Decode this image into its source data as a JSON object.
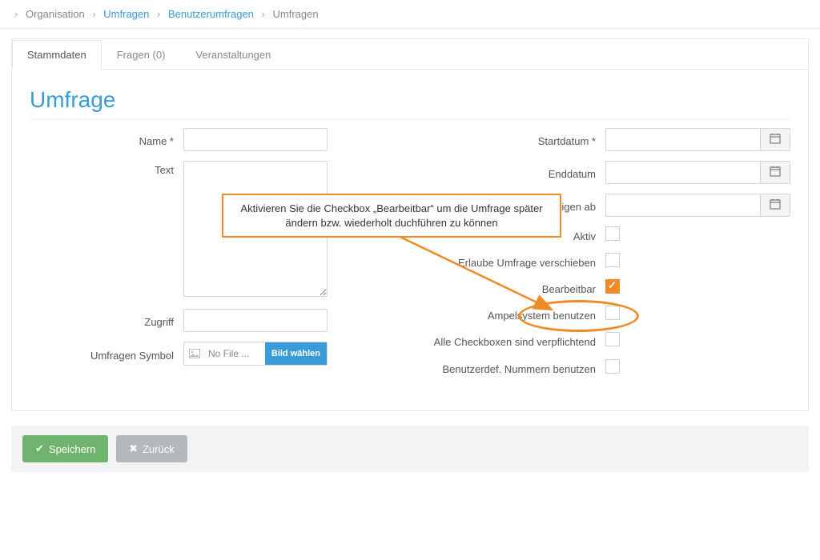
{
  "breadcrumb": {
    "root": "Organisation",
    "lvl1": "Umfragen",
    "lvl2": "Benutzerumfragen",
    "lvl3": "Umfragen"
  },
  "tabs": {
    "t0": "Stammdaten",
    "t1": "Fragen (0)",
    "t2": "Veranstaltungen"
  },
  "title": "Umfrage",
  "left": {
    "name_label": "Name *",
    "text_label": "Text",
    "zugriff_label": "Zugriff",
    "symbol_label": "Umfragen Symbol",
    "file_placeholder": "No File ...",
    "file_button": "Bild wählen"
  },
  "right": {
    "start_label": "Startdatum *",
    "end_label": "Enddatum",
    "showfrom_label": "zeigen ab",
    "active_label": "Aktiv",
    "allowmove_label": "Erlaube Umfrage verschieben",
    "editable_label": "Bearbeitbar",
    "ampel_label": "Ampelsystem benutzen",
    "allreq_label": "Alle Checkboxen sind verpflichtend",
    "usernum_label": "Benutzerdef. Nummern benutzen"
  },
  "callout": "Aktivieren Sie die Checkbox „Bearbeitbar“ um die Umfrage später ändern bzw. wiederholt duchführen zu können",
  "footer": {
    "save": "Speichern",
    "back": "Zurück"
  }
}
